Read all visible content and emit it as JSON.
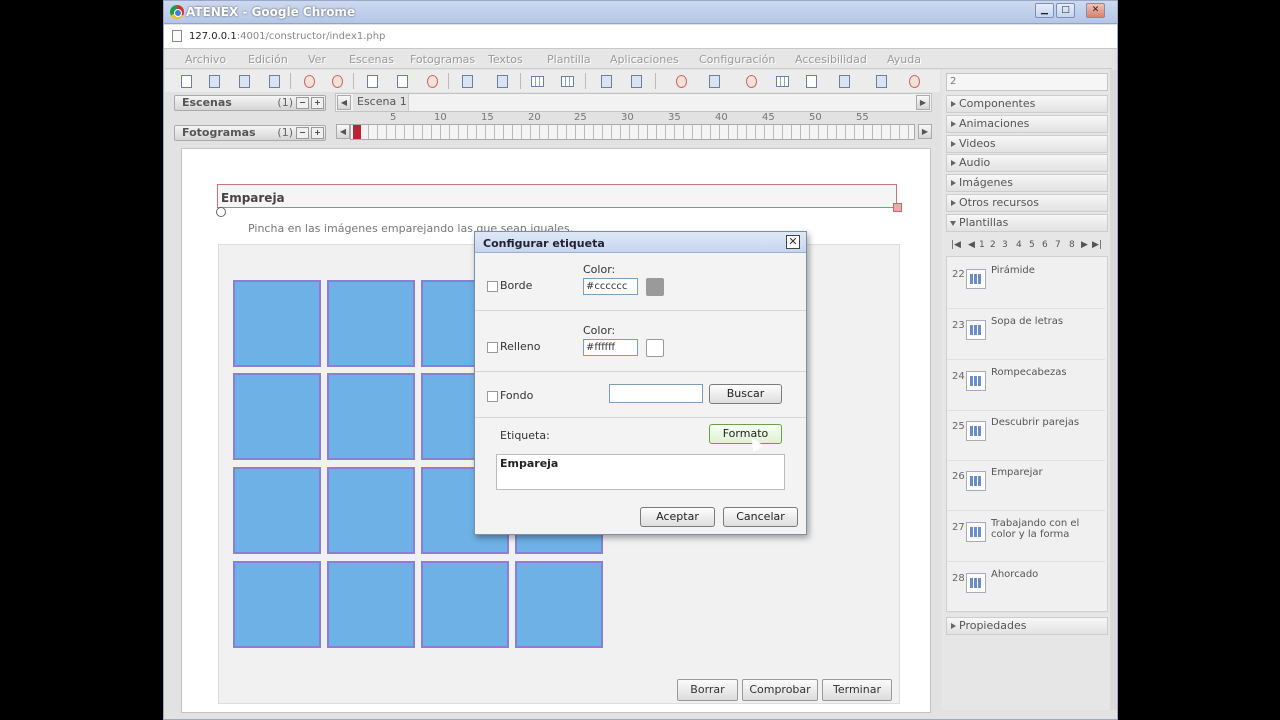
{
  "window": {
    "title": "ATENEX - Google Chrome",
    "minimize": "▁",
    "maximize": "□",
    "close": "✕"
  },
  "address": {
    "host": "127.0.0.1",
    "path": ":4001/constructor/index1.php"
  },
  "menu": [
    "Archivo",
    "Edición",
    "Ver",
    "Escenas",
    "Fotogramas",
    "Textos",
    "Plantilla",
    "Aplicaciones",
    "Configuración",
    "Accesibilidad",
    "Ayuda"
  ],
  "scenes": {
    "label": "Escenas",
    "count": "(1)",
    "tab": "Escena 1"
  },
  "frames": {
    "label": "Fotogramas",
    "count": "(1)",
    "ticks": [
      "5",
      "10",
      "15",
      "20",
      "25",
      "30",
      "35",
      "40",
      "45",
      "50",
      "55"
    ]
  },
  "stage": {
    "title": "Empareja",
    "instruction": "Pincha en las imágenes emparejando las que sean iguales."
  },
  "stage_buttons": {
    "borrar": "Borrar",
    "comprobar": "Comprobar",
    "terminar": "Terminar"
  },
  "right_panel": {
    "top_value": "2",
    "sections": [
      "Componentes",
      "Animaciones",
      "Videos",
      "Audio",
      "Imágenes",
      "Otros recursos",
      "Plantillas"
    ],
    "pager": [
      "1",
      "2",
      "3",
      "4",
      "5",
      "6",
      "7",
      "8"
    ],
    "templates": [
      {
        "num": "22",
        "label": "Pirámide"
      },
      {
        "num": "23",
        "label": "Sopa de letras"
      },
      {
        "num": "24",
        "label": "Rompecabezas"
      },
      {
        "num": "25",
        "label": "Descubrir parejas"
      },
      {
        "num": "26",
        "label": "Emparejar"
      },
      {
        "num": "27",
        "label": "Trabajando con el color y la forma"
      },
      {
        "num": "28",
        "label": "Ahorcado"
      }
    ],
    "properties": "Propiedades"
  },
  "dialog": {
    "title": "Configurar etiqueta",
    "close": "✕",
    "border_label": "Borde",
    "color_label": "Color:",
    "border_color": "#cccccc",
    "fill_label": "Relleno",
    "fill_color": "#ffffff",
    "background_label": "Fondo",
    "background_value": "",
    "search_button": "Buscar",
    "tag_label": "Etiqueta:",
    "format_button": "Formato",
    "tag_text": "Empareja",
    "accept": "Aceptar",
    "cancel": "Cancelar"
  },
  "colors": {
    "tile": "#6eb1e7",
    "tile_border": "#8a7fd4",
    "swatch_gray": "#9a9a9a",
    "title_bar": "#c6d5ee"
  }
}
